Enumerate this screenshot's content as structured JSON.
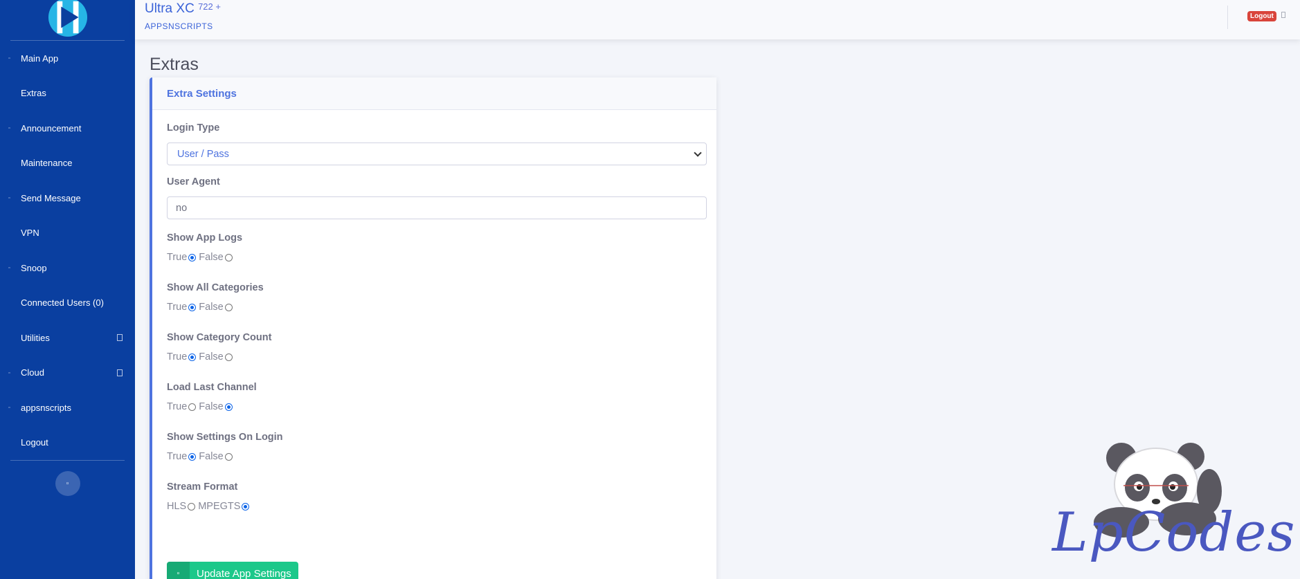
{
  "sidebar": {
    "logo_icon": "play-logo-icon",
    "items": [
      {
        "label": "Main App",
        "icon": "bullet-icon"
      },
      {
        "label": "Extras",
        "icon": ""
      },
      {
        "label": "Announcement",
        "icon": "bullet-icon"
      },
      {
        "label": "Maintenance",
        "icon": ""
      },
      {
        "label": "Send Message",
        "icon": "bullet-icon"
      },
      {
        "label": "VPN",
        "icon": ""
      },
      {
        "label": "Snoop",
        "icon": "bullet-icon"
      },
      {
        "label": "Connected Users (0)",
        "icon": ""
      },
      {
        "label": "Utilities",
        "icon": "",
        "caret": true
      },
      {
        "label": "Cloud",
        "icon": "bullet-icon",
        "caret": true
      },
      {
        "label": "appsnscripts",
        "icon": "bullet-icon"
      },
      {
        "label": "Logout",
        "icon": ""
      }
    ],
    "toggle_icon": "collapse-toggle-icon"
  },
  "topbar": {
    "title": "Ultra XC",
    "version": "722 +",
    "subtitle": "APPSNSCRIPTS",
    "logout_label": "Logout"
  },
  "page": {
    "title": "Extras"
  },
  "card": {
    "header": "Extra Settings",
    "login_type": {
      "label": "Login Type",
      "value": "User / Pass"
    },
    "user_agent": {
      "label": "User Agent",
      "value": "no"
    },
    "radios": [
      {
        "label": "Show App Logs",
        "opt1": "True",
        "opt2": "False",
        "selected": "True"
      },
      {
        "label": "Show All Categories",
        "opt1": "True",
        "opt2": "False",
        "selected": "True"
      },
      {
        "label": "Show Category Count",
        "opt1": "True",
        "opt2": "False",
        "selected": "True"
      },
      {
        "label": "Load Last Channel",
        "opt1": "True",
        "opt2": "False",
        "selected": "False"
      },
      {
        "label": "Show Settings On Login",
        "opt1": "True",
        "opt2": "False",
        "selected": "True"
      },
      {
        "label": "Stream Format",
        "opt1": "HLS",
        "opt2": "MPEGTS",
        "selected": "MPEGTS"
      }
    ],
    "update_button": "Update App Settings"
  },
  "watermark": {
    "text": "LpCodes"
  },
  "colors": {
    "sidebar": "#0a3fa0",
    "accent": "#4e73df",
    "success": "#1cc88a",
    "danger": "#d9443b"
  }
}
